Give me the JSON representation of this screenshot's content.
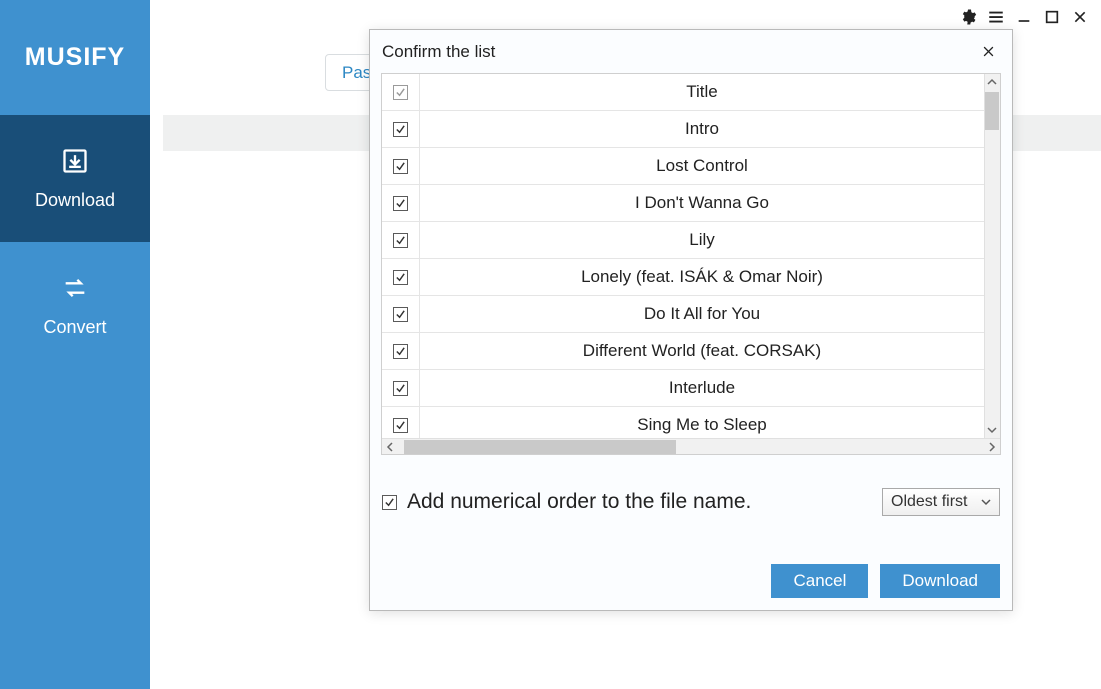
{
  "brand": "MUSIFY",
  "sidebar": {
    "items": [
      {
        "label": "Download"
      },
      {
        "label": "Convert"
      }
    ]
  },
  "toolbar": {
    "pas_label": "Pas"
  },
  "modal": {
    "title": "Confirm the list",
    "header_col": "Title",
    "tracks": [
      "Intro",
      "Lost Control",
      "I Don't Wanna Go",
      "Lily",
      "Lonely (feat. ISÁK & Omar Noir)",
      "Do It All for You",
      "Different World (feat. CORSAK)",
      "Interlude",
      "Sing Me to Sleep"
    ],
    "add_order_label": "Add numerical order to the file name.",
    "sort_options": [
      "Oldest first"
    ],
    "sort_selected": "Oldest first",
    "cancel_label": "Cancel",
    "download_label": "Download"
  }
}
